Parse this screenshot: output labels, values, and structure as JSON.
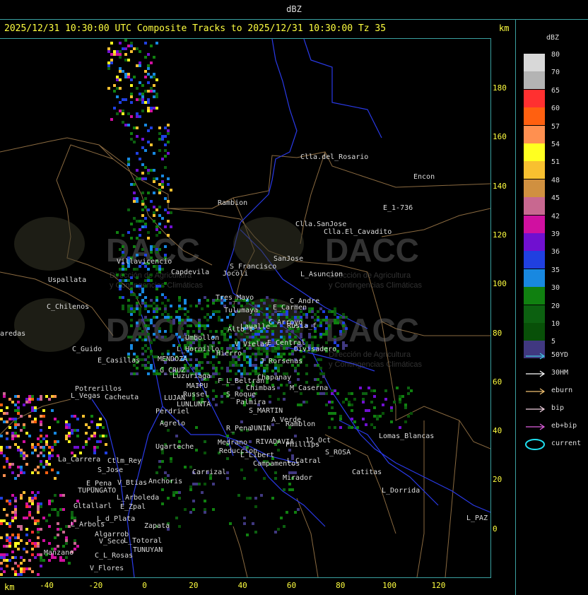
{
  "header": {
    "title": "dBZ"
  },
  "tracks_title": "2025/12/31 10:30:00 UTC Composite Tracks to 2025/12/31 10:30:00 Tz 35",
  "km_label": "km",
  "y_axis": {
    "ticks": [
      "180",
      "160",
      "140",
      "120",
      "100",
      "80",
      "60",
      "40",
      "20",
      "0"
    ]
  },
  "x_axis": {
    "ticks": [
      "-40",
      "-20",
      "0",
      "20",
      "40",
      "60",
      "80",
      "100",
      "120"
    ]
  },
  "legend": {
    "title": "dBZ",
    "scale": [
      {
        "label": "80",
        "color": "#d8d8d8"
      },
      {
        "label": "70",
        "color": "#b4b4b4"
      },
      {
        "label": "65",
        "color": "#ff3030"
      },
      {
        "label": "60",
        "color": "#ff6010"
      },
      {
        "label": "57",
        "color": "#ff9050"
      },
      {
        "label": "54",
        "color": "#ffff20"
      },
      {
        "label": "51",
        "color": "#f8c030"
      },
      {
        "label": "48",
        "color": "#d09040"
      },
      {
        "label": "45",
        "color": "#c86890"
      },
      {
        "label": "42",
        "color": "#d010a0"
      },
      {
        "label": "39",
        "color": "#7010d0"
      },
      {
        "label": "36",
        "color": "#2040e0"
      },
      {
        "label": "35",
        "color": "#1888e0"
      },
      {
        "label": "30",
        "color": "#108010"
      },
      {
        "label": "20",
        "color": "#0c6010"
      },
      {
        "label": "10",
        "color": "#085008"
      },
      {
        "label": "5",
        "color": "#403880"
      }
    ],
    "tracks": [
      {
        "label": "50YD",
        "color": "#40c8e0"
      },
      {
        "label": "30HM",
        "color": "#ffffff"
      },
      {
        "label": "eburn",
        "color": "#f0c070"
      },
      {
        "label": "bip",
        "color": "#f0d0e0"
      },
      {
        "label": "eb+bip",
        "color": "#e060e0"
      },
      {
        "label": "current",
        "color": "#20e0f0"
      }
    ]
  },
  "places": [
    "Clla.del_Rosario",
    "Encon",
    "Rambion",
    "E_1-736",
    "Clla.SanJose",
    "Clla.El_Cavadito",
    "Villavicencio",
    "Uspallata",
    "Capdevila",
    "S_Francisco",
    "SanJose",
    "L_Asuncion",
    "Jocoli",
    "C_Chilenos",
    "Tres_Mayo",
    "C_Andre",
    "E_Carmen",
    "Tulumaya",
    "C_Arroyo",
    "Alto_V",
    "Lavalle",
    "Rusia_f",
    "Umbollon",
    "V_Vielas",
    "Hierro",
    "E_Central",
    "Divisadero",
    "C_Guido",
    "E_Casillas",
    "MENDOZA",
    "L_Hornillo",
    "J_Rorsenas",
    "G_CRUZ",
    "Luzuriaga",
    "F_L_Beltran",
    "Chapanay",
    "Potrerillos",
    "Cacheuta",
    "Chimbas",
    "M_Caserna",
    "MAIPU",
    "L_Vegas",
    "Russel",
    "S_Roque",
    "LUJAN",
    "Palmira",
    "LUNLUNTA",
    "S_MARTIN",
    "Perdriel",
    "A_Verde",
    "Ramblon",
    "Agrelo",
    "R_Pena",
    "JUNIN",
    "Lomas_Blancas",
    "12_Oct",
    "RIVADAVIA",
    "Medrano",
    "Phillips",
    "Ugarteche",
    "Reduccion",
    "S_ROSA",
    "L_Libert",
    "Campamentos",
    "Ctlm_Rey",
    "La_Carrera",
    "Carrizal",
    "Catitas",
    "S_Jose",
    "L_Catral",
    "Mirador",
    "E_Pena",
    "TUPUNGATO",
    "V_Btias",
    "Anchoris",
    "L_Dorrida",
    "L_Arboleda",
    "Gltallarl",
    "E_Zpal",
    "L_PAZ",
    "L_d_Plata",
    "L_Arbols",
    "Zapata",
    "Algarrob",
    "V_Seco",
    "L_Totoral",
    "TUNUYAN",
    "Manzano",
    "C_L_Rosas",
    "V_Flores",
    "aredas"
  ],
  "watermark": {
    "brand": "DACC",
    "line1": "Dirección de Agricultura",
    "line2": "y Contingencias Climáticas"
  }
}
